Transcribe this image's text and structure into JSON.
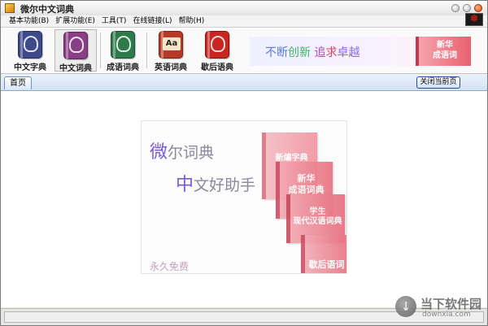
{
  "window": {
    "title": "微尔中文词典",
    "icons": {
      "app": "app-icon",
      "minimize": "minimize-icon",
      "maximize": "maximize-icon",
      "close": "close-icon",
      "flag": "maple-leaf-icon"
    }
  },
  "menu": {
    "items": [
      "基本功能(B)",
      "扩展功能(E)",
      "工具(T)",
      "在线链接(L)",
      "帮助(H)"
    ]
  },
  "toolbar": {
    "tools": [
      {
        "label": "中文字典",
        "color": "#3e4a8a",
        "icon": "dictionary-book-icon"
      },
      {
        "label": "中文词典",
        "color": "#8a3e86",
        "icon": "dictionary-book-icon"
      },
      {
        "label": "成语词典",
        "color": "#2f7a4a",
        "icon": "dictionary-book-icon"
      },
      {
        "label": "英语词典",
        "color": "#b83a26",
        "icon": "english-book-icon",
        "glyph": "Aa"
      },
      {
        "label": "歇后语典",
        "color": "#c8261f",
        "icon": "dictionary-book-icon"
      }
    ],
    "slogan": [
      "不断",
      "创新",
      " 追",
      "求",
      "卓越"
    ],
    "slogan_book": "新华\n成语词"
  },
  "tabs": {
    "home": "首页",
    "close_home": "关闭当前页"
  },
  "splash": {
    "line1_big": "微",
    "line1_rest": "尔词典",
    "line2_big": "中",
    "line2_rest": "文好助手",
    "free": "永久免费",
    "covers": [
      "新编字典",
      "新华\n成语词典",
      "学生\n现代汉语词典",
      "歇后语词"
    ]
  },
  "watermark": {
    "name": "当下软件园",
    "url": "downxia.com",
    "icon": "download-arrow-icon"
  }
}
